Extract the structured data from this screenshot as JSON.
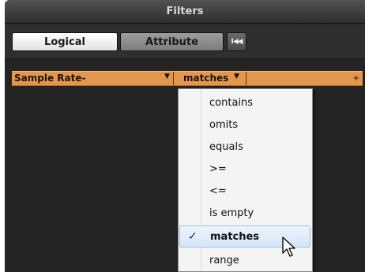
{
  "window": {
    "title": "Filters"
  },
  "toolbar": {
    "logical_label": "Logical",
    "attribute_label": "Attribute",
    "back_label": "I◀◀"
  },
  "filter_row": {
    "attribute_value": "Sample Rate-",
    "condition_value": "matches",
    "add_icon": "plus-icon"
  },
  "dropdown": {
    "items": [
      {
        "label": "contains"
      },
      {
        "label": "omits"
      },
      {
        "label": "equals"
      },
      {
        "label": ">="
      },
      {
        "label": "<="
      },
      {
        "label": "is empty"
      },
      {
        "label": "matches",
        "selected": true
      },
      {
        "label": "range"
      }
    ]
  },
  "colors": {
    "window_bg": "#242424",
    "filter_row": "#e2974e",
    "selected_item": "#d3e4f7"
  }
}
